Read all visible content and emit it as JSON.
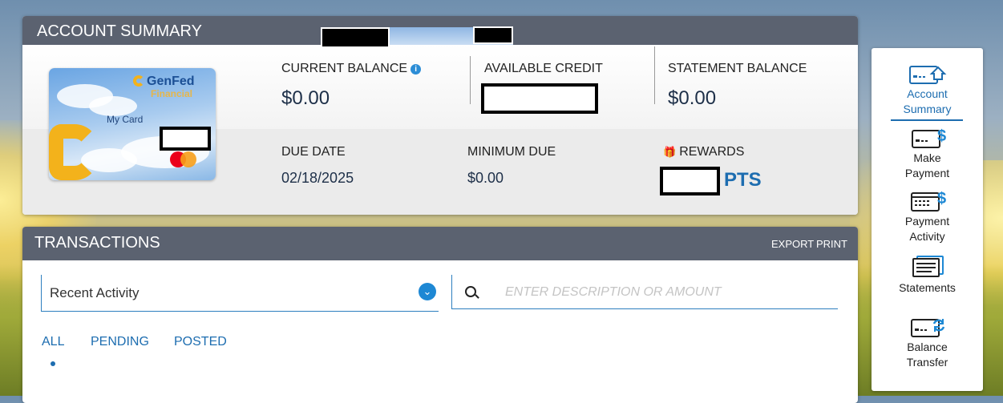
{
  "summary": {
    "title": "ACCOUNT SUMMARY",
    "current_balance_label": "CURRENT BALANCE",
    "current_balance_value": "$0.00",
    "available_credit_label": "AVAILABLE CREDIT",
    "statement_balance_label": "STATEMENT BALANCE",
    "statement_balance_value": "$0.00",
    "due_date_label": "DUE DATE",
    "due_date_value": "02/18/2025",
    "minimum_due_label": "MINIMUM DUE",
    "minimum_due_value": "$0.00",
    "rewards_label": "REWARDS",
    "rewards_unit": "PTS",
    "info_icon": "info-icon",
    "gift_icon": "gift-icon"
  },
  "card": {
    "brand": "GenFed",
    "brand_sub": "Financial",
    "name": "My Card",
    "network_icon": "mastercard-logo"
  },
  "transactions": {
    "title": "TRANSACTIONS",
    "export_label": "EXPORT",
    "print_label": "PRINT",
    "filter_selected": "Recent Activity",
    "search_placeholder": "ENTER DESCRIPTION OR AMOUNT",
    "tabs": [
      {
        "label": "ALL",
        "active": true
      },
      {
        "label": "PENDING",
        "active": false
      },
      {
        "label": "POSTED",
        "active": false
      }
    ]
  },
  "sidenav": {
    "items": [
      {
        "label_line1": "Account",
        "label_line2": "Summary",
        "icon": "card-home-icon",
        "active": true
      },
      {
        "label_line1": "Make",
        "label_line2": "Payment",
        "icon": "card-dollar-icon",
        "active": false
      },
      {
        "label_line1": "Payment",
        "label_line2": "Activity",
        "icon": "calculator-dollar-icon",
        "active": false
      },
      {
        "label_line1": "Statements",
        "label_line2": "",
        "icon": "statements-icon",
        "active": false
      },
      {
        "label_line1": "Balance",
        "label_line2": "Transfer",
        "icon": "card-transfer-icon",
        "active": false
      }
    ]
  },
  "colors": {
    "header_bg": "#5b6270",
    "accent_blue": "#1d6db0",
    "brand_yellow": "#f3b21b"
  }
}
